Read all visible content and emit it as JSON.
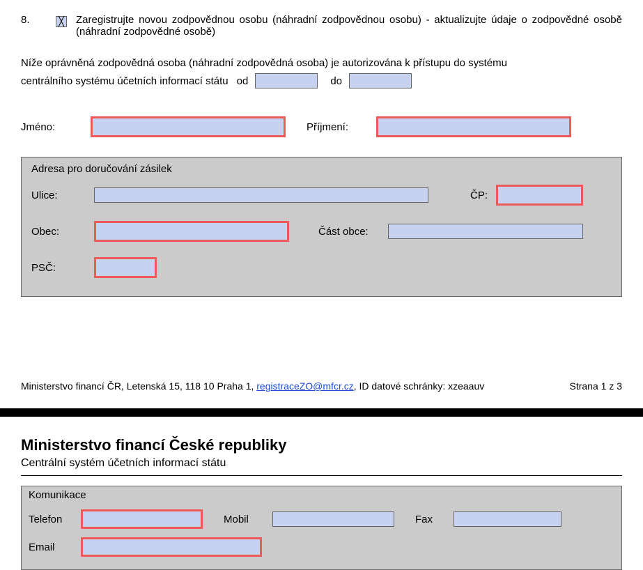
{
  "item8": {
    "number": "8.",
    "checked": "╳",
    "text": "Zaregistrujte novou zodpovědnou osobu (náhradní zodpovědnou osobu) - aktualizujte údaje o zodpovědné osobě (náhradní zodpovědné osobě)"
  },
  "auth": {
    "line1": "Níže oprávněná zodpovědná osoba (náhradní zodpovědná osoba) je autorizována k přístupu do systému",
    "line2_prefix": "centrálního systému účetních informací státu",
    "od_label": "od",
    "od_value": "",
    "do_label": "do",
    "do_value": ""
  },
  "name": {
    "first_label": "Jméno:",
    "first_value": "",
    "last_label": "Příjmení:",
    "last_value": ""
  },
  "address": {
    "legend": "Adresa pro doručování zásilek",
    "ulice_label": "Ulice:",
    "ulice_value": "",
    "cp_label": "ČP:",
    "cp_value": "",
    "obec_label": "Obec:",
    "obec_value": "",
    "cast_label": "Část obce:",
    "cast_value": "",
    "psc_label": "PSČ:",
    "psc_value": ""
  },
  "footer": {
    "prefix": "Ministerstvo financí ČR, Letenská 15, 118 10 Praha 1, ",
    "email": "registraceZO@mfcr.cz",
    "suffix": ", ID datové schránky: xzeaauv",
    "page": "Strana 1 z 3"
  },
  "page2": {
    "title": "Ministerstvo financí České republiky",
    "subtitle": "Centrální systém účetních informací státu"
  },
  "comms": {
    "legend": "Komunikace",
    "telefon_label": "Telefon",
    "telefon_value": "",
    "mobil_label": "Mobil",
    "mobil_value": "",
    "fax_label": "Fax",
    "fax_value": "",
    "email_label": "Email",
    "email_value": ""
  }
}
